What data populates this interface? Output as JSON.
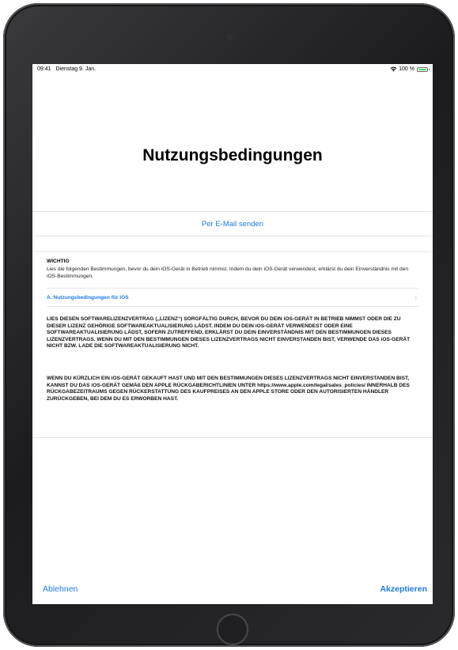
{
  "status_bar": {
    "time": "09:41",
    "date": "Dienstag 9. Jan.",
    "battery_percent": "100 %",
    "battery_level": 1.0,
    "wifi_icon": "wifi-icon",
    "battery_icon": "battery-icon",
    "battery_color": "#4cd964"
  },
  "title": "Nutzungsbedingungen",
  "email_link": "Per E-Mail senden",
  "important": {
    "heading": "WICHTIG",
    "text": "Lies die folgenden Bestimmungen, bevor du dein iOS-Gerät in Betrieb nimmst. Indem du dein iOS-Gerät verwendest, erklärst du dein Einverständnis mit den iOS-Bestimmungen."
  },
  "terms_link": {
    "label": "A. Nutzungsbedingungen für iOS",
    "icon": "chevron-right-icon"
  },
  "license_paragraphs": [
    "LIES DIESEN SOFTWARELIZENZVERTRAG („LIZENZ“) SORGFÄLTIG DURCH, BEVOR DU DEIN iOS-GERÄT IN BETRIEB NIMMST ODER DIE ZU DIESER LIZENZ GEHÖRIGE SOFTWAREAKTUALISIERUNG LÄDST. INDEM DU DEIN iOS-GERÄT VERWENDEST ODER EINE SOFTWAREAKTUALISIERUNG LÄDST, SOFERN ZUTREFFEND, ERKLÄRST DU DEIN EINVERSTÄNDNIS MIT DEN BESTIMMUNGEN DIESES LIZENZVERTRAGS. WENN DU MIT DEN BESTIMMUNGEN DIESES LIZENZVERTRAGS NICHT EINVERSTANDEN BIST, VERWENDE DAS iOS-GERÄT NICHT BZW. LADE DIE SOFTWAREAKTUALISIERUNG NICHT.",
    "WENN DU KÜRZLICH EIN iOS-GERÄT GEKAUFT HAST UND MIT DEN BESTIMMUNGEN DIESES LIZENZVERTRAGS NICHT EINVERSTANDEN BIST, KANNST DU DAS iOS-GERÄT GEMÄß DEN APPLE RÜCKGABERICHTLINIEN UNTER https://www.apple.com/legal/sales_policies/ INNERHALB DES RÜCKGABEZEITRAUMS GEGEN RÜCKERSTATTUNG DES KAUFPREISES AN DEN APPLE STORE ODER DEN AUTORISIERTEN HÄNDLER ZURÜCKGEBEN, BEI DEM DU ES ERWORBEN HAST."
  ],
  "buttons": {
    "decline": "Ablehnen",
    "accept": "Akzeptieren"
  },
  "colors": {
    "accent": "#1e7be6",
    "device_frame": "#1c1c1e",
    "separator": "#e3e3e6"
  }
}
